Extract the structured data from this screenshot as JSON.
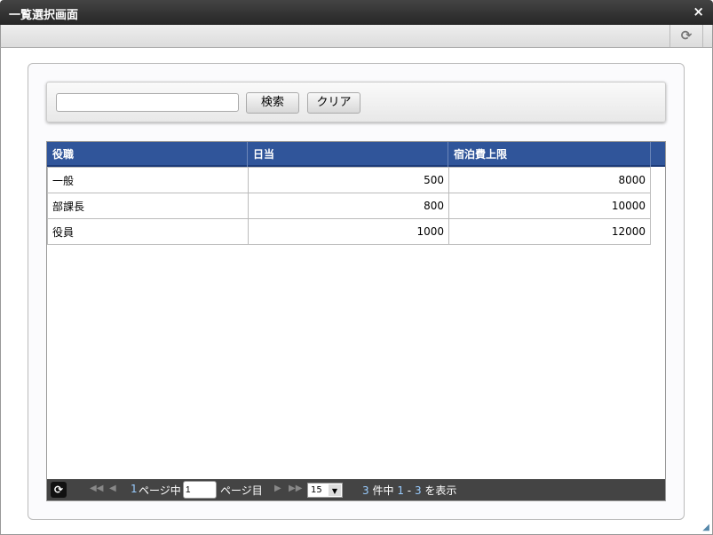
{
  "window": {
    "title": "一覧選択画面",
    "close_icon": "×",
    "refresh_icon": "⟳"
  },
  "search": {
    "value": "",
    "search_label": "検索",
    "clear_label": "クリア"
  },
  "grid": {
    "columns": [
      "役職",
      "日当",
      "宿泊費上限"
    ],
    "rows": [
      [
        "一般",
        "500",
        "8000"
      ],
      [
        "部課長",
        "800",
        "10000"
      ],
      [
        "役員",
        "1000",
        "12000"
      ]
    ]
  },
  "pager": {
    "total_pages": "1",
    "page_of_label": "ページ中",
    "page_value": "1",
    "page_suffix": "ページ目",
    "page_size": "15",
    "total": "3",
    "of_label": "件中",
    "range_from": "1",
    "range_sep": "-",
    "range_to": "3",
    "show_label": "を表示"
  }
}
